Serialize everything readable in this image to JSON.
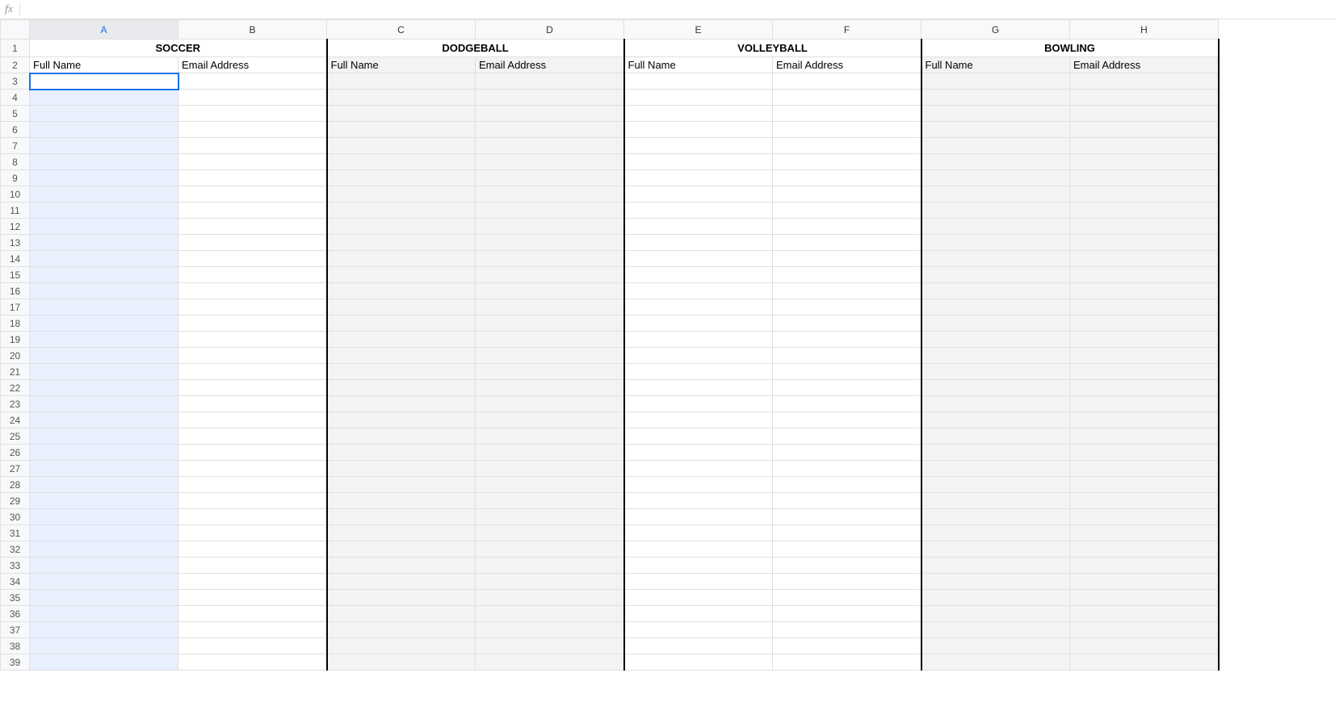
{
  "formula_bar": {
    "fx_label": "fx",
    "value": ""
  },
  "columns": [
    "A",
    "B",
    "C",
    "D",
    "E",
    "F",
    "G",
    "H"
  ],
  "rows": [
    1,
    2,
    3,
    4,
    5,
    6,
    7,
    8,
    9,
    10,
    11,
    12,
    13,
    14,
    15,
    16,
    17,
    18,
    19,
    20,
    21,
    22,
    23,
    24,
    25,
    26,
    27,
    28,
    29,
    30,
    31,
    32,
    33,
    34,
    35,
    36,
    37,
    38,
    39
  ],
  "sections": {
    "r1": {
      "ab": "SOCCER",
      "cd": "DODGEBALL",
      "ef": "VOLLEYBALL",
      "gh": "BOWLING"
    },
    "r2": {
      "full_name": "Full Name",
      "email": "Email Address"
    }
  },
  "active_cell": {
    "row": 3,
    "col": "A"
  },
  "selected_column": "A"
}
